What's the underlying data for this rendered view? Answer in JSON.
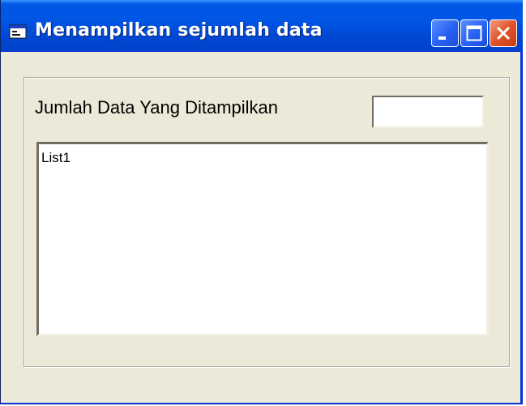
{
  "window": {
    "title": "Menampilkan sejumlah data",
    "icon": "vb-form-icon",
    "controls": {
      "minimize": "minimize-icon",
      "maximize": "maximize-icon",
      "close": "close-icon"
    },
    "colors": {
      "titlebar": "#0055e5",
      "body": "#ece9d8",
      "close": "#e0532a"
    }
  },
  "form": {
    "label": "Jumlah Data Yang Ditampilkan",
    "input_value": "",
    "list": {
      "items": [
        "List1"
      ]
    }
  }
}
